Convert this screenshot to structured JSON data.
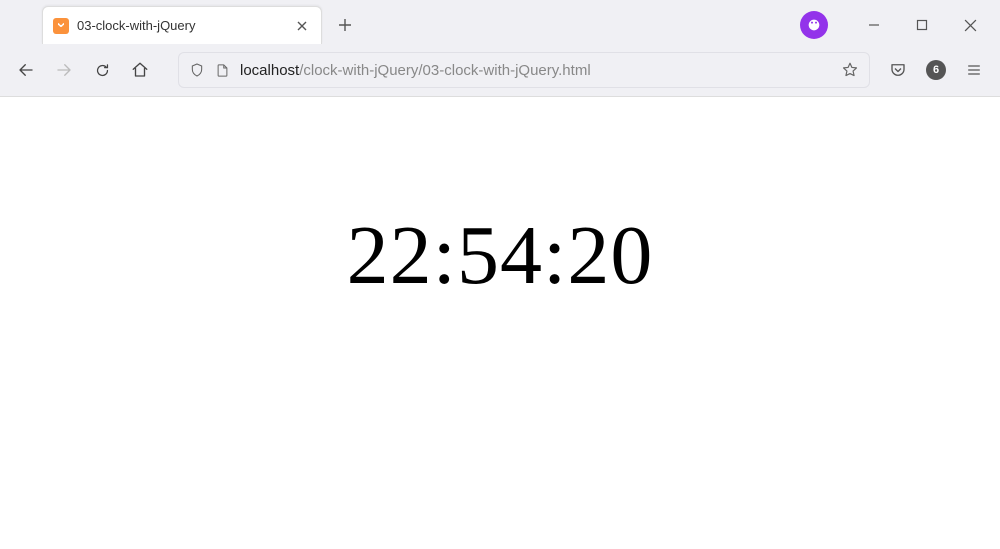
{
  "tab": {
    "title": "03-clock-with-jQuery",
    "favicon": "xampp-icon"
  },
  "url": {
    "host": "localhost",
    "path": "/clock-with-jQuery/03-clock-with-jQuery.html"
  },
  "badge": {
    "count": "6"
  },
  "page": {
    "clock_time": "22:54:20"
  }
}
